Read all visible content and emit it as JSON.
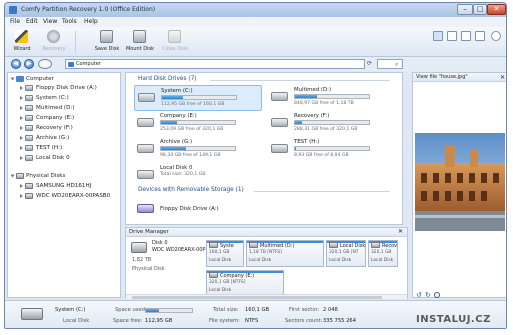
{
  "window": {
    "title": "Comfy Partition Recovery 1.0 (Office Edition)",
    "minimize": "–",
    "maximize": "□",
    "close": "✕"
  },
  "menu": [
    "File",
    "Edit",
    "View",
    "Tools",
    "Help"
  ],
  "toolbar": {
    "wizard": "Wizard",
    "recovery": "Recovery",
    "save_disk": "Save Disk",
    "mount_disk": "Mount Disk",
    "close_disk": "Close Disk"
  },
  "address": {
    "back": "◀",
    "forward": "▶",
    "path": "Computer"
  },
  "tree": {
    "root": "Computer",
    "items": [
      "Floppy Disk Drive (A:)",
      "System (C:)",
      "Multimed (D:)",
      "Company (E:)",
      "Recovery (F:)",
      "Archive (G:)",
      "TEST (H:)",
      "Local Disk 0"
    ],
    "physical_root": "Physical Disks",
    "physical_items": [
      "SAMSUNG HD161HJ",
      "WDC WD20EARX-00PASB0"
    ]
  },
  "hard_drives": {
    "header": "Hard Disk Drives (7)",
    "drives": [
      {
        "name": "System (C:)",
        "free": "112,95 GB free of 160,1 GB",
        "used_fraction": 0.29
      },
      {
        "name": "Multimed (D:)",
        "free": "848,97 GB free of 1,18 TB",
        "used_fraction": 0.3
      },
      {
        "name": "Company (E:)",
        "free": "253,09 GB free of 320,1 GB",
        "used_fraction": 0.21
      },
      {
        "name": "Recovery (F:)",
        "free": "288,31 GB free of 320,1 GB",
        "used_fraction": 0.1
      },
      {
        "name": "Archive (G:)",
        "free": "98,34 GB free of 149,1 GB",
        "used_fraction": 0.34
      },
      {
        "name": "TEST (H:)",
        "free": "8,93 GB free of 8,94 GB",
        "used_fraction": 0.01
      },
      {
        "name": "Local Disk 0",
        "free": "Total size: 320,1 GB",
        "used_fraction": 0
      }
    ]
  },
  "removable": {
    "header": "Devices with Removable Storage (1)",
    "drives": [
      {
        "name": "Floppy Disk Drive (A:)"
      }
    ]
  },
  "disk_manager": {
    "header": "Drive Manager",
    "disk": {
      "name": "Disk 0",
      "model": "WDC WD20EARX-00P",
      "size": "1,82 TB",
      "type": "Physical Disk"
    },
    "partitions": [
      {
        "name": "Syste",
        "size": "160,1 GB",
        "type": "Local Disk"
      },
      {
        "name": "Multimed (D:)",
        "size": "1,18 TB [NTFS]",
        "type": "Local Disk"
      },
      {
        "name": "Local Disk",
        "size": "320,1 GB [NT",
        "type": "Local Disk"
      },
      {
        "name": "Recov",
        "size": "320,1 GB",
        "type": "Local Disk"
      },
      {
        "name": "Company (E:)",
        "size": "320,1 GB [NTFS]",
        "type": "Local Disk"
      }
    ]
  },
  "preview": {
    "title": "View file \"house.jpg\""
  },
  "status": {
    "drive_name": "System (C:)",
    "drive_type": "Local Disk",
    "space_used_label": "Space used:",
    "space_used_fraction": 0.29,
    "space_free_label": "Space free:",
    "space_free": "112,95 GB",
    "total_size_label": "Total size:",
    "total_size": "160,1 GB",
    "file_system_label": "File system:",
    "file_system": "NTFS",
    "first_sector_label": "First sector:",
    "first_sector": "2 048",
    "sectors_count_label": "Sectors count:",
    "sectors_count": "335 755 264"
  },
  "watermark": "INSTALUJ.CZ"
}
